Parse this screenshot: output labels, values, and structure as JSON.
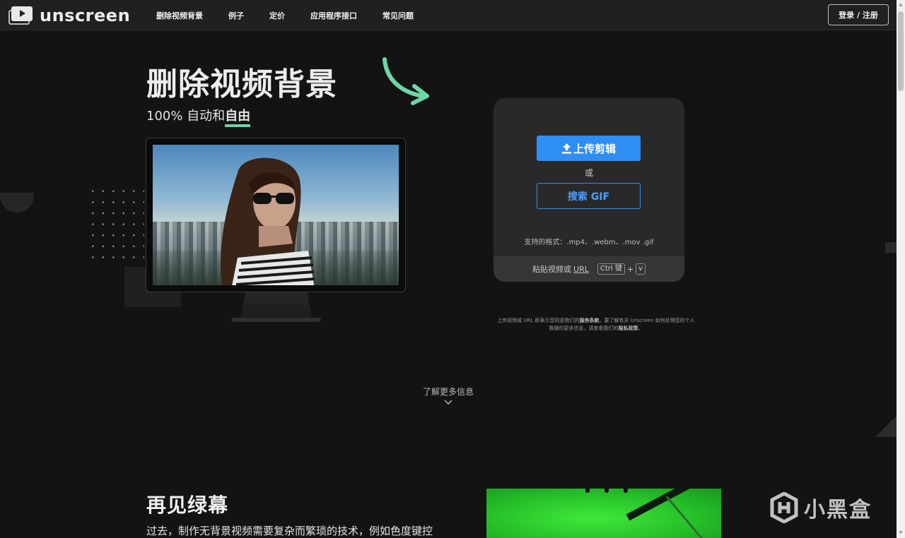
{
  "header": {
    "logo_text": "unscreen",
    "nav": [
      "删除视频背景",
      "例子",
      "定价",
      "应用程序接口",
      "常见问题"
    ],
    "login_label": "登录 / 注册"
  },
  "hero": {
    "title": "删除视频背景",
    "subtitle_prefix": "100% 自动和",
    "subtitle_emphasis": "自由"
  },
  "upload": {
    "upload_label": "上传剪辑",
    "or_label": "或",
    "gif_label": "搜索 GIF",
    "formats_label": "支持的格式：.mp4、.webm、.mov .gif",
    "paste_label": "粘贴视频或",
    "paste_url": "URL",
    "key_ctrl": "Ctrl 键",
    "key_plus": "+",
    "key_v": "v"
  },
  "terms": {
    "line1_a": "上传视频或 URL 即表示您同意我们的",
    "line1_b": "服务条款",
    "line1_c": "。要了解有关 Unscreen 如何处理您的个人",
    "line2_a": "数据的更多信息，请查看我们的",
    "line2_b": "隐私政策",
    "line2_c": "。"
  },
  "learn_more": "了解更多信息",
  "section2": {
    "title": "再见绿幕",
    "text": "过去，制作无背景视频需要复杂而繁琐的技术，例如色度键控"
  },
  "watermark": "小黑盒",
  "colors": {
    "background": "#131313",
    "accent_blue": "#2f8ef3",
    "accent_green": "#6ed6a6",
    "card": "#292929"
  },
  "icons": [
    "logo-icon",
    "upload-icon",
    "arrow-icon",
    "chevron-down-icon",
    "watermark-logo-icon"
  ]
}
